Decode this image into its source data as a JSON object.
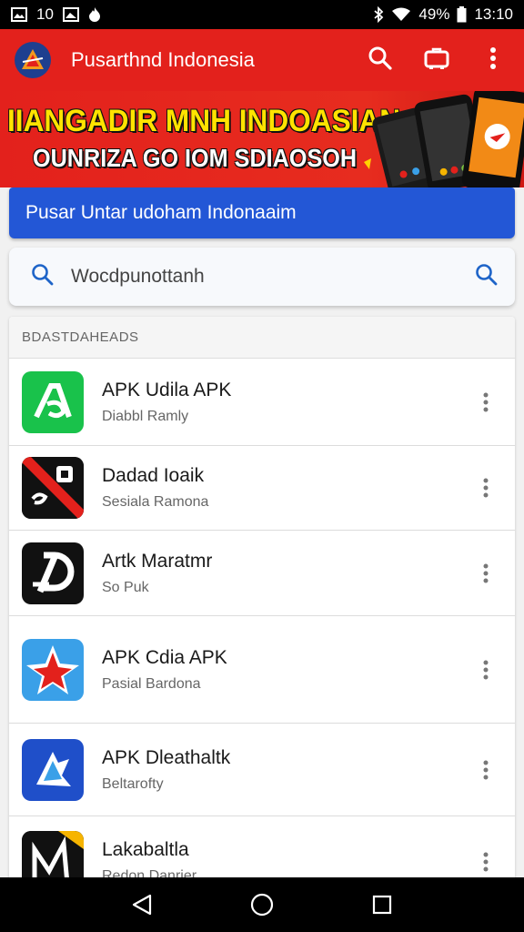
{
  "status_bar": {
    "time_left": "10",
    "battery": "49%",
    "time": "13:10"
  },
  "app_bar": {
    "title": "Pusarthnd Indonesia"
  },
  "banner": {
    "line1": "IIANGADIR MNH INDOASIAN",
    "line2": "OUNRIZA GO IOM SDIAOSOH"
  },
  "header_card": {
    "text": "Pusar Untar udoham Indonaaim"
  },
  "search": {
    "value": "Wocdpunottanh"
  },
  "list": {
    "section_title": "BDASTDAHEADS",
    "items": [
      {
        "name": "APK Udila APK",
        "subtitle": "Diabbl Ramly",
        "icon": "green-apk-icon"
      },
      {
        "name": "Dadad Ioaik",
        "subtitle": "Sesiala Ramona",
        "icon": "red-slash-icon"
      },
      {
        "name": "Artk Maratmr",
        "subtitle": "So Puk",
        "icon": "black-d-icon"
      },
      {
        "name": "APK Cdia APK",
        "subtitle": "Pasial Bardona",
        "icon": "red-star-icon"
      },
      {
        "name": "APK Dleathaltk",
        "subtitle": "Beltarofty",
        "icon": "blue-origami-icon"
      },
      {
        "name": "Lakabaltla",
        "subtitle": "Redon Danrier",
        "icon": "black-yellow-icon"
      }
    ]
  },
  "colors": {
    "app_bar": "#e3211c",
    "banner_yellow": "#ffe300",
    "header_blue": "#2357d6",
    "search_icon": "#1e64c8"
  }
}
